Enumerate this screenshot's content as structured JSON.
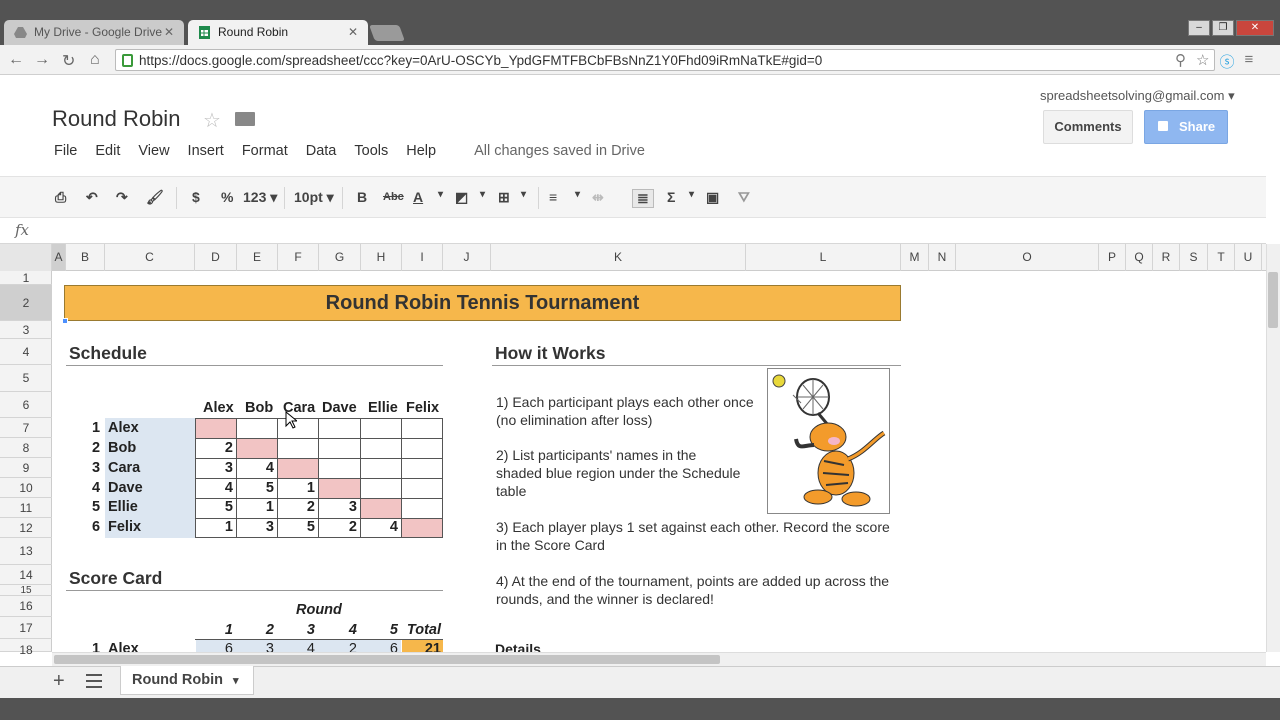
{
  "browser": {
    "tabs": [
      {
        "label": "My Drive - Google Drive"
      },
      {
        "label": "Round Robin"
      }
    ],
    "url": "https://docs.google.com/spreadsheet/ccc?key=0ArU-OSCYb_YpdGFMTFBCbFBsNnZ1Y0Fhd09iRmNaTkE#gid=0"
  },
  "doc": {
    "title": "Round Robin",
    "menu": [
      "File",
      "Edit",
      "View",
      "Insert",
      "Format",
      "Data",
      "Tools",
      "Help"
    ],
    "save_status": "All changes saved in Drive",
    "account": "spreadsheetsolving@gmail.com",
    "comments_label": "Comments",
    "share_label": "Share"
  },
  "toolbar": {
    "currency": "$",
    "percent": "%",
    "number_format": "123",
    "font_size": "10pt",
    "bold": "B",
    "strike": "Abc",
    "text_color": "A",
    "sigma": "Σ"
  },
  "formula_bar": {
    "fx": "fx"
  },
  "columns": [
    "A",
    "B",
    "C",
    "D",
    "E",
    "F",
    "G",
    "H",
    "I",
    "J",
    "K",
    "L",
    "M",
    "N",
    "O",
    "P",
    "Q",
    "R",
    "S",
    "T",
    "U"
  ],
  "rows": [
    "1",
    "2",
    "3",
    "4",
    "5",
    "6",
    "7",
    "8",
    "9",
    "10",
    "11",
    "12",
    "13",
    "14",
    "15",
    "16",
    "17",
    "18"
  ],
  "sheet": {
    "banner": "Round Robin Tennis Tournament",
    "schedule_title": "Schedule",
    "players": [
      "Alex",
      "Bob",
      "Cara",
      "Dave",
      "Ellie",
      "Felix"
    ],
    "player_numbers": [
      "1",
      "2",
      "3",
      "4",
      "5",
      "6"
    ],
    "matrix": [
      [
        "",
        "",
        "",
        "",
        "",
        ""
      ],
      [
        "2",
        "",
        "",
        "",
        "",
        ""
      ],
      [
        "3",
        "4",
        "",
        "",
        "",
        ""
      ],
      [
        "4",
        "5",
        "1",
        "",
        "",
        ""
      ],
      [
        "5",
        "1",
        "2",
        "3",
        "",
        ""
      ],
      [
        "1",
        "3",
        "5",
        "2",
        "4",
        ""
      ]
    ],
    "scorecard_title": "Score Card",
    "round_label": "Round",
    "round_numbers": [
      "1",
      "2",
      "3",
      "4",
      "5"
    ],
    "total_label": "Total",
    "score_row": {
      "num": "1",
      "name": "Alex",
      "scores": [
        "6",
        "3",
        "4",
        "2",
        "6"
      ],
      "total": "21"
    },
    "how_title": "How it Works",
    "how_steps": [
      "1) Each participant plays each other once (no elimination after loss)",
      "2) List participants' names in the shaded blue region under the Schedule table",
      "3) Each player plays 1 set against each other. Record the score in the Score Card",
      "4) At the end of the tournament, points are added up across the rounds, and the winner is declared!"
    ],
    "details_label": "Details"
  },
  "sheet_tab": {
    "label": "Round Robin"
  },
  "colors": {
    "banner": "#f6b74b",
    "names_shade": "#dce6f1",
    "diagonal": "#f2c4c4",
    "share": "#8fb7f0"
  }
}
